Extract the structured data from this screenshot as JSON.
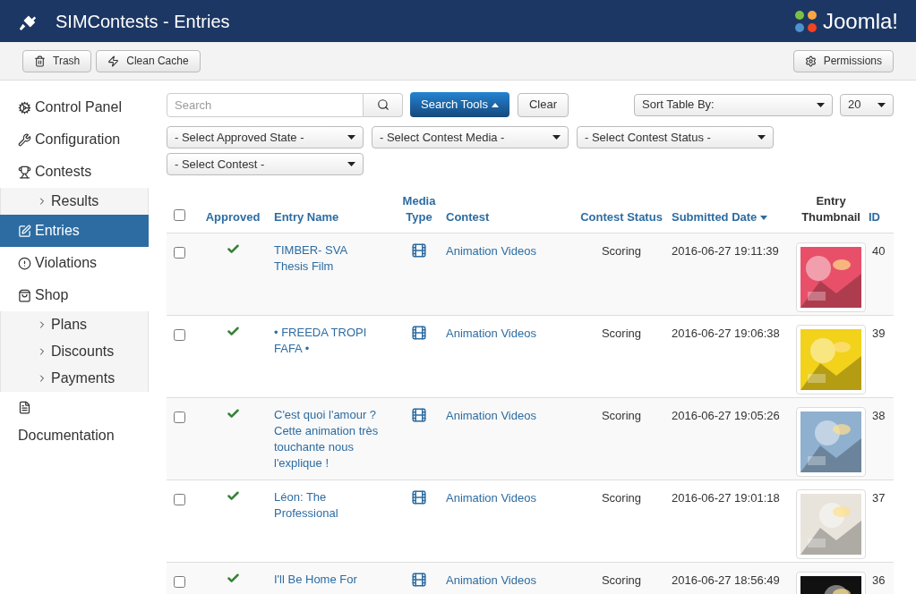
{
  "header": {
    "title": "SIMContests - Entries",
    "brand": "Joomla!"
  },
  "toolbar": {
    "left": [
      {
        "label": "Trash"
      },
      {
        "label": "Clean Cache"
      }
    ],
    "right": [
      {
        "label": "Permissions"
      }
    ]
  },
  "sidebar": [
    {
      "kind": "main",
      "label": "Control Panel",
      "selected": false
    },
    {
      "kind": "main",
      "label": "Configuration",
      "selected": false
    },
    {
      "kind": "main",
      "label": "Contests",
      "selected": false
    },
    {
      "kind": "sub",
      "label": "Results",
      "selected": false
    },
    {
      "kind": "main",
      "label": "Entries",
      "selected": true
    },
    {
      "kind": "main",
      "label": "Violations",
      "selected": false
    },
    {
      "kind": "main",
      "label": "Shop",
      "selected": false
    },
    {
      "kind": "sub",
      "label": "Plans",
      "selected": false
    },
    {
      "kind": "sub",
      "label": "Discounts",
      "selected": false
    },
    {
      "kind": "sub",
      "label": "Payments",
      "selected": false
    },
    {
      "kind": "doc",
      "label": "Documentation",
      "selected": false
    }
  ],
  "search": {
    "placeholder": "Search",
    "tools_button": "Search Tools",
    "clear_button": "Clear",
    "sort": "Sort Table By:",
    "limit": "20"
  },
  "filters": [
    "- Select Approved State -",
    "- Select Contest Media -",
    "- Select Contest Status -",
    "- Select Contest -"
  ],
  "table": {
    "select_all": false,
    "columns": [
      {
        "label": "Approved",
        "sortable": true,
        "sorted": false
      },
      {
        "label": "Entry Name",
        "sortable": true,
        "sorted": false
      },
      {
        "label": "Media Type",
        "sortable": true,
        "sorted": false
      },
      {
        "label": "Contest",
        "sortable": true,
        "sorted": false
      },
      {
        "label": "Contest Status",
        "sortable": true,
        "sorted": false
      },
      {
        "label": "Submitted Date",
        "sortable": true,
        "sorted": true
      },
      {
        "label": "Entry Thumbnail",
        "sortable": false,
        "sorted": false
      },
      {
        "label": "ID",
        "sortable": true,
        "sorted": false
      }
    ],
    "rows": [
      {
        "checked": false,
        "approved": true,
        "name": "TIMBER- SVA Thesis Film",
        "contest": "Animation Videos",
        "status": "Scoring",
        "date": "2016-06-27 19:11:39",
        "id": "40"
      },
      {
        "checked": false,
        "approved": true,
        "name": "• FREEDA TROPI FAFA •",
        "contest": "Animation Videos",
        "status": "Scoring",
        "date": "2016-06-27 19:06:38",
        "id": "39"
      },
      {
        "checked": false,
        "approved": true,
        "name": "C'est quoi l'amour ? Cette animation très touchante nous l'explique !",
        "contest": "Animation Videos",
        "status": "Scoring",
        "date": "2016-06-27 19:05:26",
        "id": "38"
      },
      {
        "checked": false,
        "approved": true,
        "name": "Léon: The Professional",
        "contest": "Animation Videos",
        "status": "Scoring",
        "date": "2016-06-27 19:01:18",
        "id": "37"
      },
      {
        "checked": false,
        "approved": true,
        "name": "I'll Be Home For",
        "contest": "Animation Videos",
        "status": "Scoring",
        "date": "2016-06-27 18:56:49",
        "id": "36"
      }
    ]
  }
}
